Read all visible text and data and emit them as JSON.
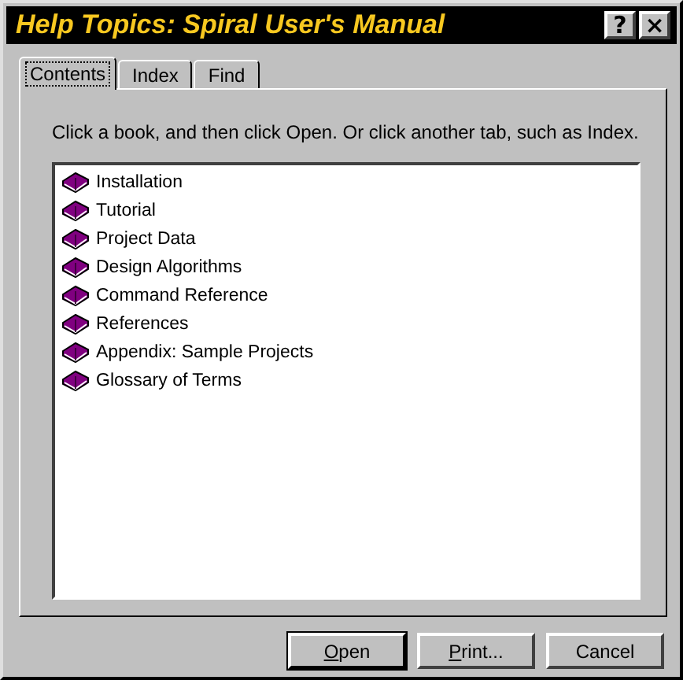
{
  "window": {
    "title": "Help Topics: Spiral User's Manual",
    "controls": [
      {
        "label": "?"
      },
      {
        "label": "×"
      }
    ]
  },
  "tabs": [
    {
      "label": "Contents",
      "selected": true
    },
    {
      "label": "Index",
      "selected": false
    },
    {
      "label": "Find",
      "selected": false
    }
  ],
  "instructions": "Click a book, and then click Open. Or click another tab, such as Index.",
  "books": [
    {
      "label": "Installation"
    },
    {
      "label": "Tutorial"
    },
    {
      "label": "Project Data"
    },
    {
      "label": "Design Algorithms"
    },
    {
      "label": "Command Reference"
    },
    {
      "label": "References"
    },
    {
      "label": "Appendix: Sample Projects"
    },
    {
      "label": "Glossary of Terms"
    }
  ],
  "buttons": [
    {
      "label": "Open",
      "default": true,
      "underline_first": true
    },
    {
      "label": "Print...",
      "default": false,
      "underline_first": true
    },
    {
      "label": "Cancel",
      "default": false,
      "underline_first": false
    }
  ]
}
